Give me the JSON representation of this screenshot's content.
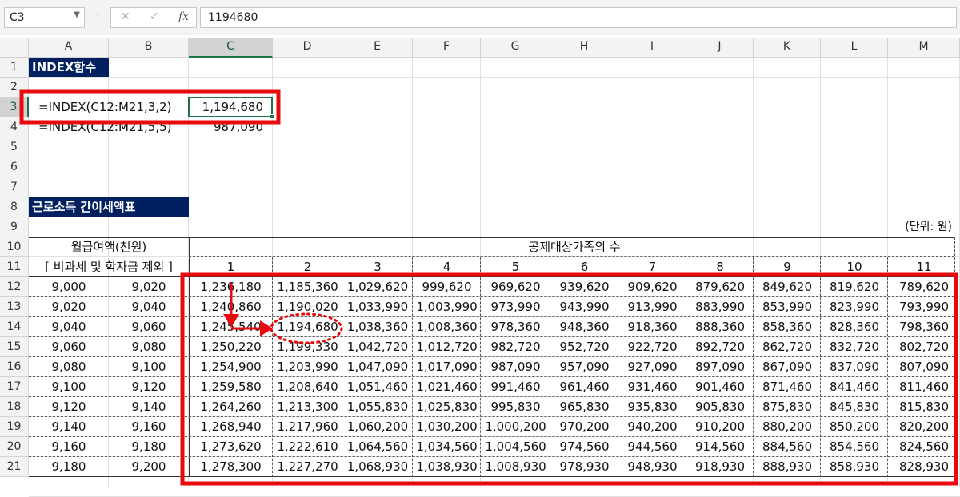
{
  "formula_bar": {
    "name_box": "C3",
    "cancel_icon": "✕",
    "enter_icon": "✓",
    "fx_label": "fx",
    "value": "1194680"
  },
  "columns": [
    "A",
    "B",
    "C",
    "D",
    "E",
    "F",
    "G",
    "H",
    "I",
    "J",
    "K",
    "L",
    "M"
  ],
  "rows": [
    "1",
    "2",
    "3",
    "4",
    "5",
    "6",
    "7",
    "8",
    "9",
    "10",
    "11",
    "12",
    "13",
    "14",
    "15",
    "16",
    "17",
    "18",
    "19",
    "20",
    "21"
  ],
  "selected_column": "C",
  "selected_row": "3",
  "cells": {
    "A1": "INDEX함수",
    "A3": "=INDEX(C12:M21,3,2)",
    "C3": "1,194,680",
    "A4": "=INDEX(C12:M21,5,5)",
    "C4": "987,090",
    "A8": "근로소득 간이세액표",
    "M9": "(단위: 원)",
    "A10": "월급여액(천원)",
    "A11": "[ 비과세 및 학자금 제외 ]",
    "C10": "공제대상가족의 수"
  },
  "family_counts": [
    "1",
    "2",
    "3",
    "4",
    "5",
    "6",
    "7",
    "8",
    "9",
    "10",
    "11"
  ],
  "table_rows": [
    {
      "from": "9,000",
      "to": "9,020",
      "vals": [
        "1,236,180",
        "1,185,360",
        "1,029,620",
        "999,620",
        "969,620",
        "939,620",
        "909,620",
        "879,620",
        "849,620",
        "819,620",
        "789,620"
      ]
    },
    {
      "from": "9,020",
      "to": "9,040",
      "vals": [
        "1,240,860",
        "1,190,020",
        "1,033,990",
        "1,003,990",
        "973,990",
        "943,990",
        "913,990",
        "883,990",
        "853,990",
        "823,990",
        "793,990"
      ]
    },
    {
      "from": "9,040",
      "to": "9,060",
      "vals": [
        "1,245,540",
        "1,194,680",
        "1,038,360",
        "1,008,360",
        "978,360",
        "948,360",
        "918,360",
        "888,360",
        "858,360",
        "828,360",
        "798,360"
      ]
    },
    {
      "from": "9,060",
      "to": "9,080",
      "vals": [
        "1,250,220",
        "1,199,330",
        "1,042,720",
        "1,012,720",
        "982,720",
        "952,720",
        "922,720",
        "892,720",
        "862,720",
        "832,720",
        "802,720"
      ]
    },
    {
      "from": "9,080",
      "to": "9,100",
      "vals": [
        "1,254,900",
        "1,203,990",
        "1,047,090",
        "1,017,090",
        "987,090",
        "957,090",
        "927,090",
        "897,090",
        "867,090",
        "837,090",
        "807,090"
      ]
    },
    {
      "from": "9,100",
      "to": "9,120",
      "vals": [
        "1,259,580",
        "1,208,640",
        "1,051,460",
        "1,021,460",
        "991,460",
        "961,460",
        "931,460",
        "901,460",
        "871,460",
        "841,460",
        "811,460"
      ]
    },
    {
      "from": "9,120",
      "to": "9,140",
      "vals": [
        "1,264,260",
        "1,213,300",
        "1,055,830",
        "1,025,830",
        "995,830",
        "965,830",
        "935,830",
        "905,830",
        "875,830",
        "845,830",
        "815,830"
      ]
    },
    {
      "from": "9,140",
      "to": "9,160",
      "vals": [
        "1,268,940",
        "1,217,960",
        "1,060,200",
        "1,030,200",
        "1,000,200",
        "970,200",
        "940,200",
        "910,200",
        "880,200",
        "850,200",
        "820,200"
      ]
    },
    {
      "from": "9,160",
      "to": "9,180",
      "vals": [
        "1,273,620",
        "1,222,610",
        "1,064,560",
        "1,034,560",
        "1,004,560",
        "974,560",
        "944,560",
        "914,560",
        "884,560",
        "854,560",
        "824,560"
      ]
    },
    {
      "from": "9,180",
      "to": "9,200",
      "vals": [
        "1,278,300",
        "1,227,270",
        "1,068,930",
        "1,038,930",
        "1,008,930",
        "978,930",
        "948,930",
        "918,930",
        "888,930",
        "858,930",
        "828,930"
      ]
    }
  ],
  "colors": {
    "title_bg": "#002060",
    "highlight": "#e8090c",
    "selection": "#217346"
  }
}
